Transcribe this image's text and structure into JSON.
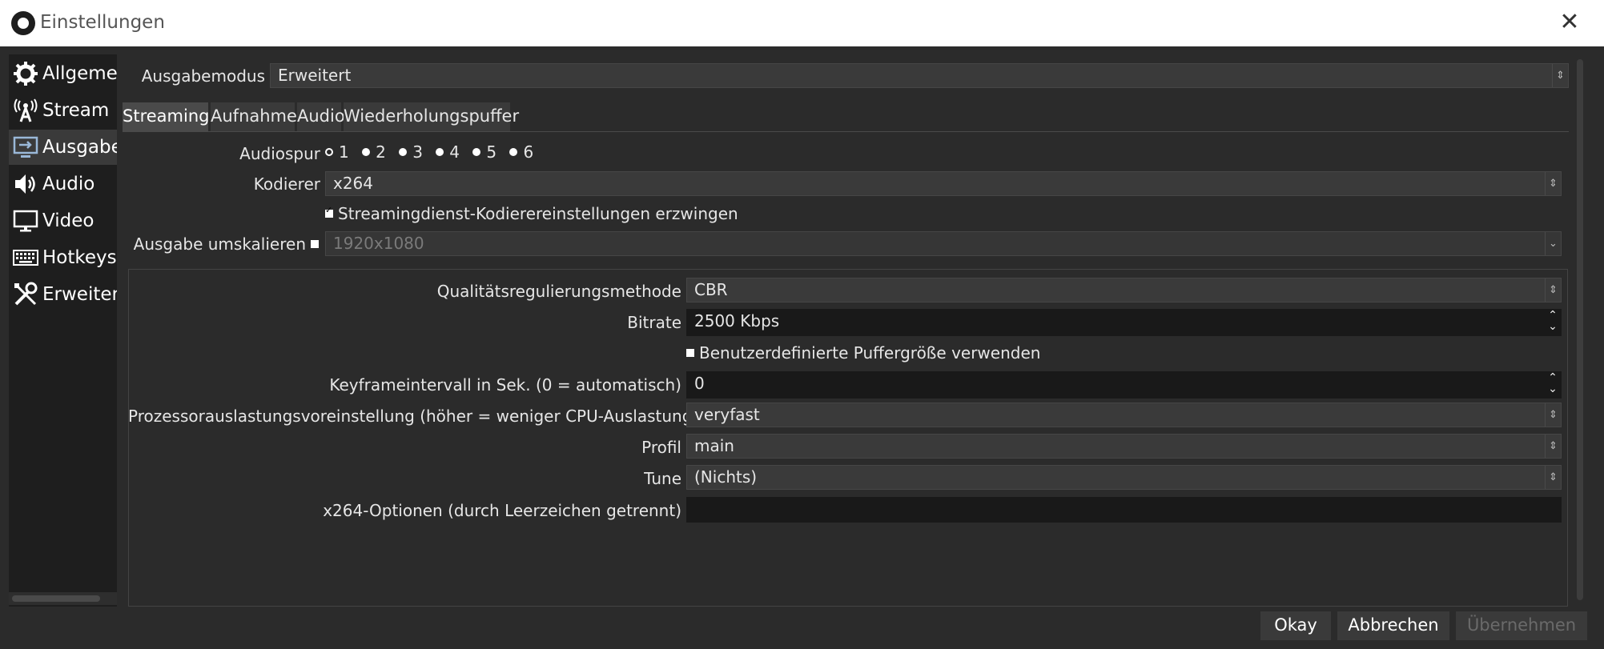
{
  "window": {
    "title": "Einstellungen",
    "close_icon": "close-icon"
  },
  "sidebar": {
    "items": [
      {
        "label": "Allgemein",
        "icon": "gear-icon",
        "active": false
      },
      {
        "label": "Stream",
        "icon": "broadcast-icon",
        "active": false
      },
      {
        "label": "Ausgabe",
        "icon": "output-icon",
        "active": true
      },
      {
        "label": "Audio",
        "icon": "speaker-icon",
        "active": false
      },
      {
        "label": "Video",
        "icon": "monitor-icon",
        "active": false
      },
      {
        "label": "Hotkeys",
        "icon": "keyboard-icon",
        "active": false
      },
      {
        "label": "Erweitert",
        "icon": "tools-icon",
        "active": false
      }
    ]
  },
  "output_mode": {
    "label": "Ausgabemodus",
    "value": "Erweitert"
  },
  "tabs": [
    {
      "label": "Streaming",
      "active": true
    },
    {
      "label": "Aufnahme",
      "active": false
    },
    {
      "label": "Audio",
      "active": false
    },
    {
      "label": "Wiederholungspuffer",
      "active": false
    }
  ],
  "streaming": {
    "audiospur": {
      "label": "Audiospur",
      "tracks": [
        "1",
        "2",
        "3",
        "4",
        "5",
        "6"
      ],
      "selected": "1"
    },
    "encoder": {
      "label": "Kodierer",
      "value": "x264"
    },
    "enforce": {
      "label": "Streamingdienst-Kodierereinstellungen erzwingen",
      "checked": true
    },
    "rescale": {
      "label": "Ausgabe umskalieren",
      "checked": false,
      "value": "1920x1080"
    }
  },
  "encoder_settings": {
    "rate_control": {
      "label": "Qualitätsregulierungsmethode",
      "value": "CBR"
    },
    "bitrate": {
      "label": "Bitrate",
      "value": "2500 Kbps"
    },
    "custom_buffer": {
      "label": "Benutzerdefinierte Puffergröße verwenden",
      "checked": false
    },
    "keyframe": {
      "label": "Keyframeintervall in Sek. (0 = automatisch)",
      "value": "0"
    },
    "preset": {
      "label": "Prozessorauslastungsvoreinstellung (höher = weniger CPU-Auslastung)",
      "value": "veryfast"
    },
    "profile": {
      "label": "Profil",
      "value": "main"
    },
    "tune": {
      "label": "Tune",
      "value": "(Nichts)"
    },
    "x264opts": {
      "label": "x264-Optionen (durch Leerzeichen getrennt)",
      "value": ""
    }
  },
  "buttons": {
    "ok": "Okay",
    "cancel": "Abbrechen",
    "apply": "Übernehmen"
  }
}
